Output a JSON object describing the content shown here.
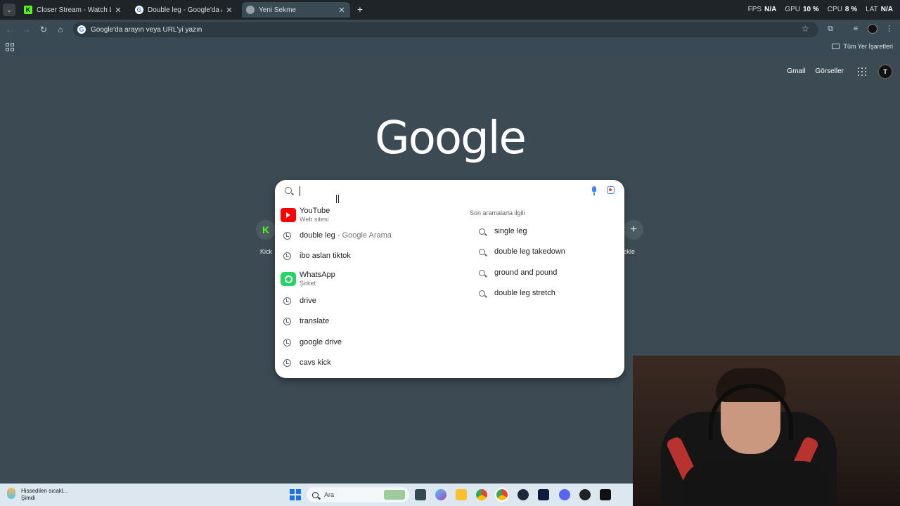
{
  "tabs": [
    {
      "title": "Closer Stream - Watch Live on Kick",
      "favicon": "kick-logo-icon",
      "active": false
    },
    {
      "title": "Double leg - Google'da Ara",
      "favicon": "google-icon",
      "active": false
    },
    {
      "title": "Yeni Sekme",
      "favicon": "chrome-icon",
      "active": true
    }
  ],
  "perf": {
    "fps_label": "FPS",
    "fps_value": "N/A",
    "gpu_label": "GPU",
    "gpu_value": "10 %",
    "cpu_label": "CPU",
    "cpu_value": "8 %",
    "lat_label": "LAT",
    "lat_value": "N/A"
  },
  "omnibox": {
    "placeholder": "Google'da arayın veya URL'yi yazın"
  },
  "bookmarks": {
    "all_label": "Tüm Yer İşaretleri"
  },
  "header_links": {
    "gmail": "Gmail",
    "images": "Görseller"
  },
  "logo_text": "Google",
  "search": {
    "value": "",
    "nav_suggestions": [
      {
        "title": "YouTube",
        "subtitle": "Web sitesi",
        "icon": "youtube-icon"
      },
      {
        "title": "WhatsApp",
        "subtitle": "Şirket",
        "icon": "whatsapp-icon"
      }
    ],
    "history": [
      {
        "text": "double leg",
        "suffix": " - Google Arama"
      },
      {
        "text": "ibo aslan tiktok"
      },
      {
        "text": "drive"
      },
      {
        "text": "translate"
      },
      {
        "text": "google drive"
      },
      {
        "text": "cavs kick"
      }
    ],
    "related_title": "Son aramalarla ilgili",
    "related": [
      "single leg",
      "double leg takedown",
      "ground and pound",
      "double leg stretch"
    ]
  },
  "shortcuts": {
    "kick_label": "Kick",
    "add_label": "Kısayol ekle"
  },
  "taskbar": {
    "weather_line1": "Hissedilen sıcakl...",
    "weather_line2": "Şimdi",
    "search_placeholder": "Ara"
  },
  "colors": {
    "page_bg": "#3c4a53",
    "kick_green": "#53fc18",
    "youtube_red": "#ff0000",
    "whatsapp_green": "#25d366"
  }
}
